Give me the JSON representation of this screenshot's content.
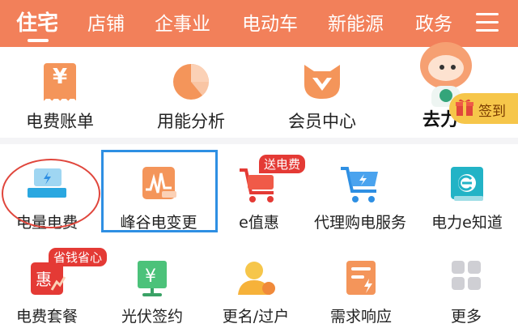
{
  "tabs": [
    "住宅",
    "店铺",
    "企事业",
    "电动车",
    "新能源",
    "政务"
  ],
  "quick_services": [
    {
      "label": "电费账单",
      "icon": "bill-yen-icon"
    },
    {
      "label": "用能分析",
      "icon": "pie-chart-icon"
    },
    {
      "label": "会员中心",
      "icon": "fox-member-icon"
    }
  ],
  "clipped_text": "去力",
  "signin_label": "签到",
  "grid_row1": [
    {
      "label": "电量电费",
      "icon": "electricity-bill-icon"
    },
    {
      "label": "峰谷电变更",
      "icon": "peak-valley-icon"
    },
    {
      "label": "e值惠",
      "icon": "cart-e-icon",
      "badge": "送电费"
    },
    {
      "label": "代理购电服务",
      "icon": "shopping-cart-bolt-icon"
    },
    {
      "label": "电力e知道",
      "icon": "e-book-icon"
    }
  ],
  "grid_row2": [
    {
      "label": "电费套餐",
      "icon": "package-discount-icon",
      "badge": "省钱省心"
    },
    {
      "label": "光伏签约",
      "icon": "solar-yen-icon"
    },
    {
      "label": "更名/过户",
      "icon": "user-transfer-icon"
    },
    {
      "label": "需求响应",
      "icon": "clipboard-bolt-icon"
    },
    {
      "label": "更多",
      "icon": "more-grid-icon"
    }
  ],
  "colors": {
    "brand": "#f2805a",
    "highlight": "#2e8fe3",
    "circle": "#e0463c",
    "badge": "#e43a35"
  }
}
